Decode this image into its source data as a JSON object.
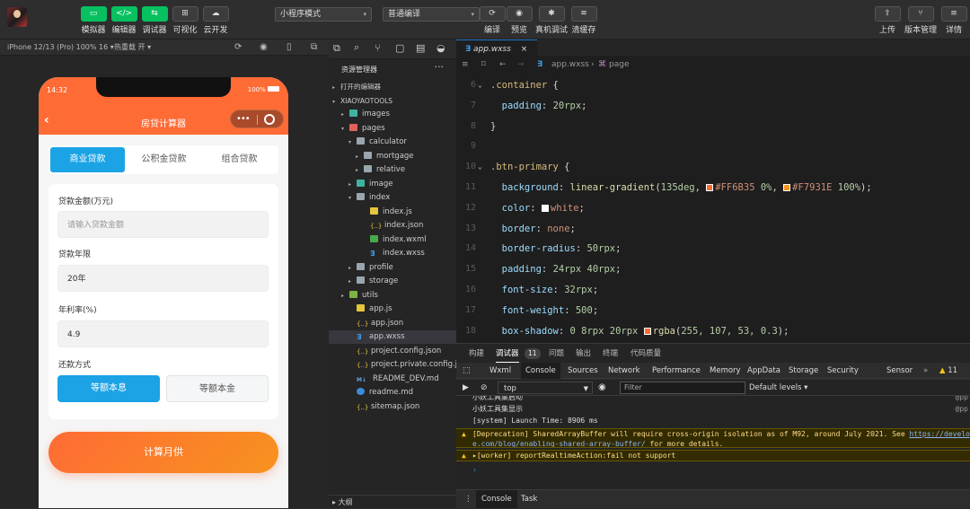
{
  "toolbar": {
    "modes": [
      {
        "label": "模拟器",
        "icon": "phone-icon",
        "glyph": "▭"
      },
      {
        "label": "编辑器",
        "icon": "code-icon",
        "glyph": "</>"
      },
      {
        "label": "调试器",
        "icon": "debug-icon",
        "glyph": "⇆"
      },
      {
        "label": "可视化",
        "icon": "layout-icon",
        "glyph": "⊞"
      },
      {
        "label": "云开发",
        "icon": "cloud-icon",
        "glyph": "☁"
      }
    ],
    "mode_select": "小程序模式",
    "compile_select": "普通编译",
    "actions": [
      {
        "label": "编译",
        "icon": "refresh-icon",
        "glyph": "⟳"
      },
      {
        "label": "预览",
        "icon": "eye-icon",
        "glyph": "◉"
      },
      {
        "label": "真机调试",
        "icon": "bug-icon",
        "glyph": "✱"
      },
      {
        "label": "清缓存",
        "icon": "layers-icon",
        "glyph": "≋"
      }
    ],
    "right": [
      {
        "label": "上传",
        "icon": "upload-icon",
        "glyph": "⇧"
      },
      {
        "label": "版本管理",
        "icon": "branch-icon",
        "glyph": "⑂"
      },
      {
        "label": "详情",
        "icon": "menu-icon",
        "glyph": "≡"
      }
    ]
  },
  "simulator": {
    "device": "iPhone 12/13 (Pro) 100% 16 ▾",
    "hotreload": "热重载 开 ▾",
    "status_time": "14:32",
    "battery": "100%",
    "page_title": "房贷计算器",
    "loan_tabs": [
      "商业贷款",
      "公积金贷款",
      "组合贷款"
    ],
    "amount_label": "贷款金额(万元)",
    "amount_placeholder": "请输入贷款金额",
    "years_label": "贷款年限",
    "years_value": "20年",
    "rate_label": "年利率(%)",
    "rate_value": "4.9",
    "method_label": "还款方式",
    "methods": [
      "等额本息",
      "等额本金"
    ],
    "calc_button": "计算月供"
  },
  "explorer": {
    "title": "资源管理器",
    "more": "···",
    "rows": [
      {
        "label": "打开的编辑器",
        "arrow": "▸",
        "icon": "",
        "indent": 4,
        "section": true
      },
      {
        "label": "XIAOYAOTOOLS",
        "arrow": "▾",
        "icon": "",
        "indent": 4,
        "section": true
      },
      {
        "label": "images",
        "arrow": "▸",
        "icon": "img",
        "indent": 14
      },
      {
        "label": "pages",
        "arrow": "▾",
        "icon": "pages",
        "indent": 14
      },
      {
        "label": "calculator",
        "arrow": "▾",
        "icon": "folder",
        "indent": 22
      },
      {
        "label": "mortgage",
        "arrow": "▸",
        "icon": "folder",
        "indent": 30
      },
      {
        "label": "relative",
        "arrow": "▸",
        "icon": "folder",
        "indent": 30
      },
      {
        "label": "image",
        "arrow": "▸",
        "icon": "img",
        "indent": 22
      },
      {
        "label": "index",
        "arrow": "▾",
        "icon": "folder",
        "indent": 22
      },
      {
        "label": "index.js",
        "arrow": "",
        "icon": "js",
        "indent": 37
      },
      {
        "label": "index.json",
        "arrow": "",
        "icon": "json",
        "indent": 37
      },
      {
        "label": "index.wxml",
        "arrow": "",
        "icon": "wxml",
        "indent": 37
      },
      {
        "label": "index.wxss",
        "arrow": "",
        "icon": "wxss",
        "indent": 37
      },
      {
        "label": "profile",
        "arrow": "▸",
        "icon": "folder",
        "indent": 22
      },
      {
        "label": "storage",
        "arrow": "▸",
        "icon": "folder",
        "indent": 22
      },
      {
        "label": "utils",
        "arrow": "▸",
        "icon": "utils",
        "indent": 14
      },
      {
        "label": "app.js",
        "arrow": "",
        "icon": "js",
        "indent": 22
      },
      {
        "label": "app.json",
        "arrow": "",
        "icon": "json",
        "indent": 22
      },
      {
        "label": "app.wxss",
        "arrow": "",
        "icon": "wxss",
        "indent": 22,
        "selected": true
      },
      {
        "label": "project.config.json",
        "arrow": "",
        "icon": "json",
        "indent": 22
      },
      {
        "label": "project.private.config.js...",
        "arrow": "",
        "icon": "json",
        "indent": 22
      },
      {
        "label": "README_DEV.md",
        "arrow": "",
        "icon": "md",
        "indent": 22
      },
      {
        "label": "readme.md",
        "arrow": "",
        "icon": "info",
        "indent": 22
      },
      {
        "label": "sitemap.json",
        "arrow": "",
        "icon": "json",
        "indent": 22
      }
    ],
    "outline": "▸ 大纲"
  },
  "editor": {
    "tab": "app.wxss",
    "crumb_file": "app.wxss",
    "crumb_sym": "page",
    "lines": [
      {
        "n": "6",
        "fold": "⌄",
        "parts": [
          [
            ".container",
            "sel"
          ],
          [
            " {",
            "punc"
          ]
        ]
      },
      {
        "n": "7",
        "parts": [
          [
            "  padding",
            "prop"
          ],
          [
            ": ",
            "punc"
          ],
          [
            "20rpx",
            "num"
          ],
          [
            ";",
            "punc"
          ]
        ]
      },
      {
        "n": "8",
        "parts": [
          [
            "}",
            "punc"
          ]
        ]
      },
      {
        "n": "9",
        "parts": []
      },
      {
        "n": "10",
        "fold": "⌄",
        "parts": [
          [
            ".btn-primary",
            "sel"
          ],
          [
            " {",
            "punc"
          ]
        ]
      },
      {
        "n": "11",
        "parts": [
          [
            "  background",
            "prop"
          ],
          [
            ": ",
            "punc"
          ],
          [
            "linear-gradient",
            "fn"
          ],
          [
            "(",
            "punc"
          ],
          [
            "135deg",
            "num"
          ],
          [
            ", ",
            "punc"
          ],
          [
            "§#FF6B35",
            "swatch"
          ],
          [
            "#FF6B35",
            "kw"
          ],
          [
            " 0%",
            "num"
          ],
          [
            ", ",
            "punc"
          ],
          [
            "§#F7931E",
            "swatch"
          ],
          [
            "#F7931E",
            "kw"
          ],
          [
            " 100%",
            "num"
          ],
          [
            ");",
            "punc"
          ]
        ]
      },
      {
        "n": "12",
        "parts": [
          [
            "  color",
            "prop"
          ],
          [
            ": ",
            "punc"
          ],
          [
            "§#FFFFFF",
            "swatch"
          ],
          [
            "white",
            "kw"
          ],
          [
            ";",
            "punc"
          ]
        ]
      },
      {
        "n": "13",
        "parts": [
          [
            "  border",
            "prop"
          ],
          [
            ": ",
            "punc"
          ],
          [
            "none",
            "kw"
          ],
          [
            ";",
            "punc"
          ]
        ]
      },
      {
        "n": "14",
        "parts": [
          [
            "  border-radius",
            "prop"
          ],
          [
            ": ",
            "punc"
          ],
          [
            "50rpx",
            "num"
          ],
          [
            ";",
            "punc"
          ]
        ]
      },
      {
        "n": "15",
        "parts": [
          [
            "  padding",
            "prop"
          ],
          [
            ": ",
            "punc"
          ],
          [
            "24rpx 40rpx",
            "num"
          ],
          [
            ";",
            "punc"
          ]
        ]
      },
      {
        "n": "16",
        "parts": [
          [
            "  font-size",
            "prop"
          ],
          [
            ": ",
            "punc"
          ],
          [
            "32rpx",
            "num"
          ],
          [
            ";",
            "punc"
          ]
        ]
      },
      {
        "n": "17",
        "parts": [
          [
            "  font-weight",
            "prop"
          ],
          [
            ": ",
            "punc"
          ],
          [
            "500",
            "num"
          ],
          [
            ";",
            "punc"
          ]
        ]
      },
      {
        "n": "18",
        "parts": [
          [
            "  box-shadow",
            "prop"
          ],
          [
            ": ",
            "punc"
          ],
          [
            "0 8rpx 20rpx ",
            "num"
          ],
          [
            "§#FF6B35",
            "swatch"
          ],
          [
            "rgba",
            "fn"
          ],
          [
            "(",
            "punc"
          ],
          [
            "255, 107, 53, 0.3",
            "num"
          ],
          [
            ");",
            "punc"
          ]
        ]
      }
    ]
  },
  "panel": {
    "tabs": [
      "构建",
      "调试器",
      "问题",
      "输出",
      "终端",
      "代码质量"
    ],
    "debug_count": "11",
    "devtools_tabs": [
      "Wxml",
      "Console",
      "Sources",
      "Network",
      "Performance",
      "Memory",
      "AppData",
      "Storage",
      "Security",
      "Sensor"
    ],
    "more": "»",
    "warn_count": "11",
    "context": "top",
    "filter_placeholder": "Filter",
    "levels": "Default levels ▾",
    "console_lines": [
      {
        "text": "小妖工具集启动",
        "src": "@pp",
        "warn": false,
        "partial": true
      },
      {
        "text": "小妖工具集显示",
        "src": "@pp",
        "warn": false
      },
      {
        "text": "[system] Launch Time: 8906 ms",
        "src": "",
        "warn": false
      },
      {
        "text": "[Deprecation] SharedArrayBuffer will require cross-origin isolation as of M92, around July 2021. See ",
        "link1": "https://developer",
        "text2": "",
        "link2": "e.com/blog/enabling-shared-array-buffer/",
        "text3": " for more details.",
        "warn": true
      },
      {
        "text": "▸[worker] reportRealtimeAction:fail not support",
        "src": "",
        "warn": true
      }
    ],
    "prompt": "›",
    "drawer_tabs": [
      "Console",
      "Task"
    ]
  }
}
